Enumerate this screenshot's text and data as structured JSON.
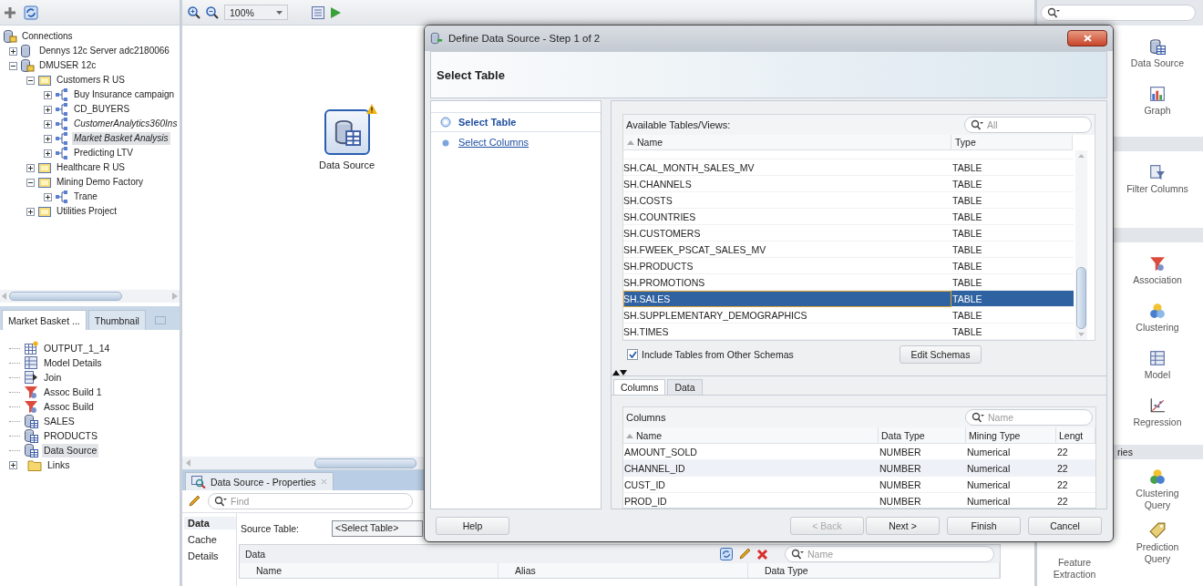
{
  "left_panel": {
    "tree": {
      "label": "Connections",
      "kind": "connections",
      "children": [
        {
          "label": "Dennys 12c Server adc2180066",
          "kind": "server",
          "expanded": false
        },
        {
          "label": "DMUSER 12c",
          "kind": "schema",
          "expanded": true,
          "children": [
            {
              "label": "Customers R US",
              "kind": "project",
              "expanded": true,
              "children": [
                {
                  "label": "Buy Insurance campaign",
                  "kind": "workflow",
                  "expanded": false,
                  "italic": false,
                  "selected": false
                },
                {
                  "label": "CD_BUYERS",
                  "kind": "workflow",
                  "expanded": false,
                  "italic": false,
                  "selected": false
                },
                {
                  "label": "CustomerAnalytics360Ins",
                  "kind": "workflow",
                  "expanded": false,
                  "italic": true,
                  "selected": false
                },
                {
                  "label": "Market Basket Analysis",
                  "kind": "workflow",
                  "expanded": false,
                  "italic": true,
                  "selected": true
                },
                {
                  "label": "Predicting LTV",
                  "kind": "workflow",
                  "expanded": false,
                  "italic": false,
                  "selected": false
                }
              ]
            },
            {
              "label": "Healthcare R US",
              "kind": "project",
              "expanded": false
            },
            {
              "label": "Mining Demo Factory",
              "kind": "project",
              "expanded": true,
              "children": [
                {
                  "label": "Trane",
                  "kind": "workflow",
                  "expanded": false,
                  "italic": false,
                  "selected": false
                }
              ]
            },
            {
              "label": "Utilities Project",
              "kind": "project",
              "expanded": false
            }
          ]
        }
      ]
    },
    "tabs": [
      {
        "label": "Market Basket ...",
        "selected": true
      },
      {
        "label": "Thumbnail",
        "selected": false
      }
    ],
    "workflow_items": [
      {
        "label": "OUTPUT_1_14",
        "kind": "output",
        "selected": false
      },
      {
        "label": "Model Details",
        "kind": "model",
        "selected": false
      },
      {
        "label": "Join",
        "kind": "join",
        "selected": false
      },
      {
        "label": "Assoc Build 1",
        "kind": "assoc",
        "selected": false
      },
      {
        "label": "Assoc Build",
        "kind": "assoc",
        "selected": false
      },
      {
        "label": "SALES",
        "kind": "datasource",
        "selected": false
      },
      {
        "label": "PRODUCTS",
        "kind": "datasource",
        "selected": false
      },
      {
        "label": "Data Source",
        "kind": "datasource",
        "selected": true
      },
      {
        "label": "Links",
        "kind": "folder",
        "selected": false,
        "expanded": false
      }
    ]
  },
  "editor": {
    "zoom": "100%",
    "nodes": [
      {
        "label": "Data Source",
        "kind": "datasource",
        "warning": true
      }
    ]
  },
  "properties": {
    "title": "Data Source - Properties",
    "search_placeholder": "Find",
    "sections": [
      {
        "label": "Data",
        "selected": true
      },
      {
        "label": "Cache",
        "selected": false
      },
      {
        "label": "Details",
        "selected": false
      }
    ],
    "source_table_label": "Source Table:",
    "source_table_value": "<Select Table>",
    "grid_title": "Data",
    "grid_search_placeholder": "Name",
    "columns": [
      "Name",
      "Alias",
      "Data Type"
    ]
  },
  "palette": {
    "groups": [
      {
        "items": [
          {
            "label": "Data Source",
            "kind": "datasource"
          },
          {
            "label": "Graph",
            "kind": "graph"
          }
        ]
      },
      {
        "items": [
          {
            "label": "Filter Columns",
            "kind": "filter"
          }
        ]
      },
      {
        "items": [
          {
            "label": "Association",
            "kind": "assoc"
          },
          {
            "label": "Clustering",
            "kind": "cluster"
          },
          {
            "label": "Model",
            "kind": "model"
          },
          {
            "label": "Regression",
            "kind": "regression"
          }
        ]
      },
      {
        "title": "ries",
        "items": [
          {
            "label": "Clustering Query",
            "kind": "clusterquery"
          },
          {
            "label": "Prediction Query",
            "kind": "prediction"
          }
        ],
        "left_items": [
          {
            "label": "Feature Extraction"
          }
        ]
      }
    ]
  },
  "dialog": {
    "title": "Define Data Source - Step 1 of 2",
    "header": "Select Table",
    "steps": [
      {
        "label": "Select Table",
        "selected": true
      },
      {
        "label": "Select Columns",
        "selected": false
      }
    ],
    "tables": {
      "label": "Available Tables/Views:",
      "search_placeholder": "All",
      "columns": [
        "Name",
        "Type"
      ],
      "rows": [
        {
          "name": "SH.CAL_MONTH_SALES_MV",
          "type": "TABLE",
          "selected": false
        },
        {
          "name": "SH.CHANNELS",
          "type": "TABLE",
          "selected": false
        },
        {
          "name": "SH.COSTS",
          "type": "TABLE",
          "selected": false
        },
        {
          "name": "SH.COUNTRIES",
          "type": "TABLE",
          "selected": false
        },
        {
          "name": "SH.CUSTOMERS",
          "type": "TABLE",
          "selected": false
        },
        {
          "name": "SH.FWEEK_PSCAT_SALES_MV",
          "type": "TABLE",
          "selected": false
        },
        {
          "name": "SH.PRODUCTS",
          "type": "TABLE",
          "selected": false
        },
        {
          "name": "SH.PROMOTIONS",
          "type": "TABLE",
          "selected": false
        },
        {
          "name": "SH.SALES",
          "type": "TABLE",
          "selected": true
        },
        {
          "name": "SH.SUPPLEMENTARY_DEMOGRAPHICS",
          "type": "TABLE",
          "selected": false
        },
        {
          "name": "SH.TIMES",
          "type": "TABLE",
          "selected": false
        }
      ]
    },
    "include_other_schemas": {
      "label": "Include Tables from Other Schemas",
      "checked": true
    },
    "edit_schemas": "Edit Schemas",
    "tabs": [
      {
        "label": "Columns",
        "selected": true
      },
      {
        "label": "Data",
        "selected": false
      }
    ],
    "columns_grid": {
      "title": "Columns",
      "search_placeholder": "Name",
      "columns": [
        "Name",
        "Data Type",
        "Mining Type",
        "Lengt"
      ],
      "rows": [
        {
          "cells": [
            "AMOUNT_SOLD",
            "NUMBER",
            "Numerical",
            "22"
          ],
          "hovered": false
        },
        {
          "cells": [
            "CHANNEL_ID",
            "NUMBER",
            "Numerical",
            "22"
          ],
          "hovered": true
        },
        {
          "cells": [
            "CUST_ID",
            "NUMBER",
            "Numerical",
            "22"
          ],
          "hovered": false
        },
        {
          "cells": [
            "PROD_ID",
            "NUMBER",
            "Numerical",
            "22"
          ],
          "hovered": false
        }
      ]
    },
    "buttons": [
      {
        "label": "Help",
        "disabled": false
      },
      {
        "label": "< Back",
        "disabled": true
      },
      {
        "label": "Next >",
        "disabled": false
      },
      {
        "label": "Finish",
        "disabled": false
      },
      {
        "label": "Cancel",
        "disabled": false
      }
    ]
  }
}
